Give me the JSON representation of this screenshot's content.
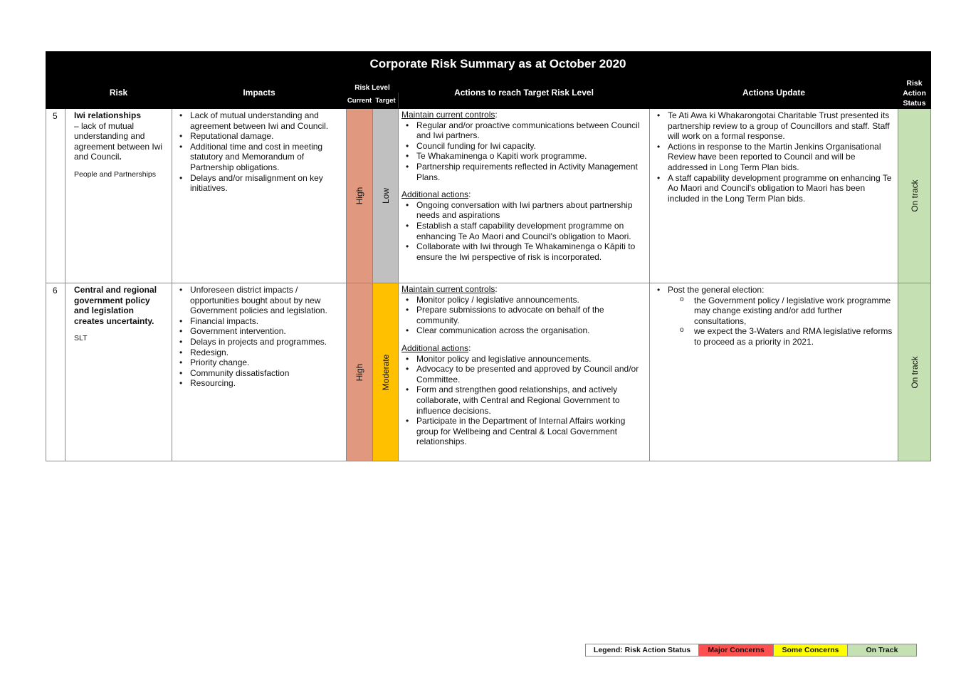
{
  "document": {
    "title": "Corporate Risk Summary as at October 2020",
    "columns": {
      "risk": "Risk",
      "impacts": "Impacts",
      "risk_level": "Risk Level",
      "current": "Current",
      "target": "Target",
      "actions": "Actions to reach Target Risk Level",
      "actions_update": "Actions Update",
      "status_line1": "Risk",
      "status_line2": "Action",
      "status_line3": "Status"
    },
    "colors": {
      "high": "#e0997f",
      "low": "#c0c0c0",
      "moderate": "#ffc000",
      "on_track": "#c5e0b3",
      "major_concerns": "#ff5050",
      "some_concerns": "#ffff00",
      "header": "#000000"
    },
    "rows": [
      {
        "number": "5",
        "risk_title": "Iwi relationships",
        "risk_desc_before": "– lack of mutual understanding and agreement between Iwi and Council",
        "risk_desc_end": ".",
        "owner": "People and Partnerships",
        "impacts": [
          "Lack of mutual understanding and agreement between Iwi and Council.",
          "Reputational damage.",
          "Additional time and cost in meeting statutory and Memorandum of Partnership obligations.",
          "Delays and/or misalignment on key initiatives."
        ],
        "current_level": "High",
        "target_level": "Low",
        "maintain_heading": "Maintain current controls",
        "maintain_controls": [
          "Regular and/or proactive communications between Council and Iwi partners.",
          "Council funding for Iwi capacity.",
          "Te Whakaminenga o Kapiti work programme.",
          "Partnership requirements reflected in Activity Management Plans."
        ],
        "additional_heading": "Additional actions",
        "additional_actions": [
          "Ongoing conversation with Iwi partners about partnership needs and aspirations",
          "Establish a staff capability development programme on enhancing Te Ao Maori and Council's obligation to Maori.",
          "Collaborate with Iwi through Te Whakaminenga o Kāpiti to ensure the Iwi perspective of risk is incorporated."
        ],
        "updates": [
          "Te Ati Awa ki Whakarongotai Charitable Trust presented its partnership review to a group of Councillors and staff.  Staff will work on a formal response.",
          "Actions in response to the Martin Jenkins Organisational Review have been reported to Council and will be addressed in Long Term Plan bids.",
          "A staff capability development programme on enhancing Te Ao Maori and Council's obligation to Maori has been included in the Long Term Plan bids."
        ],
        "status": "On track"
      },
      {
        "number": "6",
        "risk_title": "Central and regional government policy and legislation creates uncertainty.",
        "owner": "SLT",
        "impacts": [
          "Unforeseen district impacts / opportunities bought about by new Government policies and legislation.",
          "Financial impacts.",
          "Government intervention.",
          "Delays in projects and programmes.",
          "Redesign.",
          "Priority change.",
          "Community dissatisfaction",
          "Resourcing."
        ],
        "current_level": "High",
        "target_level": "Moderate",
        "maintain_heading": "Maintain current controls",
        "maintain_controls": [
          "Monitor policy / legislative announcements.",
          "Prepare submissions to advocate on behalf of the community.",
          "Clear communication across the organisation."
        ],
        "additional_heading": "Additional actions",
        "additional_actions": [
          "Monitor policy and legislative announcements.",
          "Advocacy to be presented and approved by Council and/or Committee.",
          "Form and strengthen good relationships, and actively collaborate, with Central and Regional Government to influence decisions.",
          "Participate in the Department of Internal Affairs working group for Wellbeing and Central & Local Government relationships."
        ],
        "update_lead": "Post the general election:",
        "update_subitems": [
          "the Government policy / legislative work programme may change existing and/or add further consultations,",
          "we expect the 3-Waters and RMA legislative reforms to proceed as a priority in 2021."
        ],
        "status": "On track"
      }
    ]
  },
  "legend": {
    "title": "Legend: Risk Action Status",
    "major": "Major Concerns",
    "some": "Some Concerns",
    "on_track": "On Track"
  }
}
